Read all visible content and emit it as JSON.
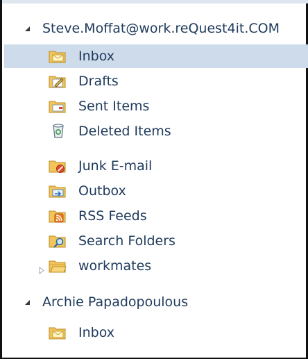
{
  "accounts": [
    {
      "name": "Steve.Moffat@work.reQuest4it.COM",
      "folders": [
        {
          "label": "Inbox",
          "icon": "inbox-folder-icon"
        },
        {
          "label": "Drafts",
          "icon": "drafts-folder-icon"
        },
        {
          "label": "Sent Items",
          "icon": "sent-items-folder-icon"
        },
        {
          "label": "Deleted Items",
          "icon": "deleted-items-icon"
        },
        {
          "label": "Junk E-mail",
          "icon": "junk-email-folder-icon"
        },
        {
          "label": "Outbox",
          "icon": "outbox-folder-icon"
        },
        {
          "label": "RSS Feeds",
          "icon": "rss-feeds-folder-icon"
        },
        {
          "label": "Search Folders",
          "icon": "search-folders-icon"
        },
        {
          "label": "workmates",
          "icon": "workmates-folder-icon"
        }
      ]
    },
    {
      "name": "Archie Papadopoulous",
      "folders": [
        {
          "label": "Inbox",
          "icon": "inbox-folder-icon"
        }
      ]
    }
  ],
  "selected_folder": "Inbox",
  "colors": {
    "text": "#1e395b",
    "selection": "#cddbea",
    "folder": "#f2c45a"
  }
}
